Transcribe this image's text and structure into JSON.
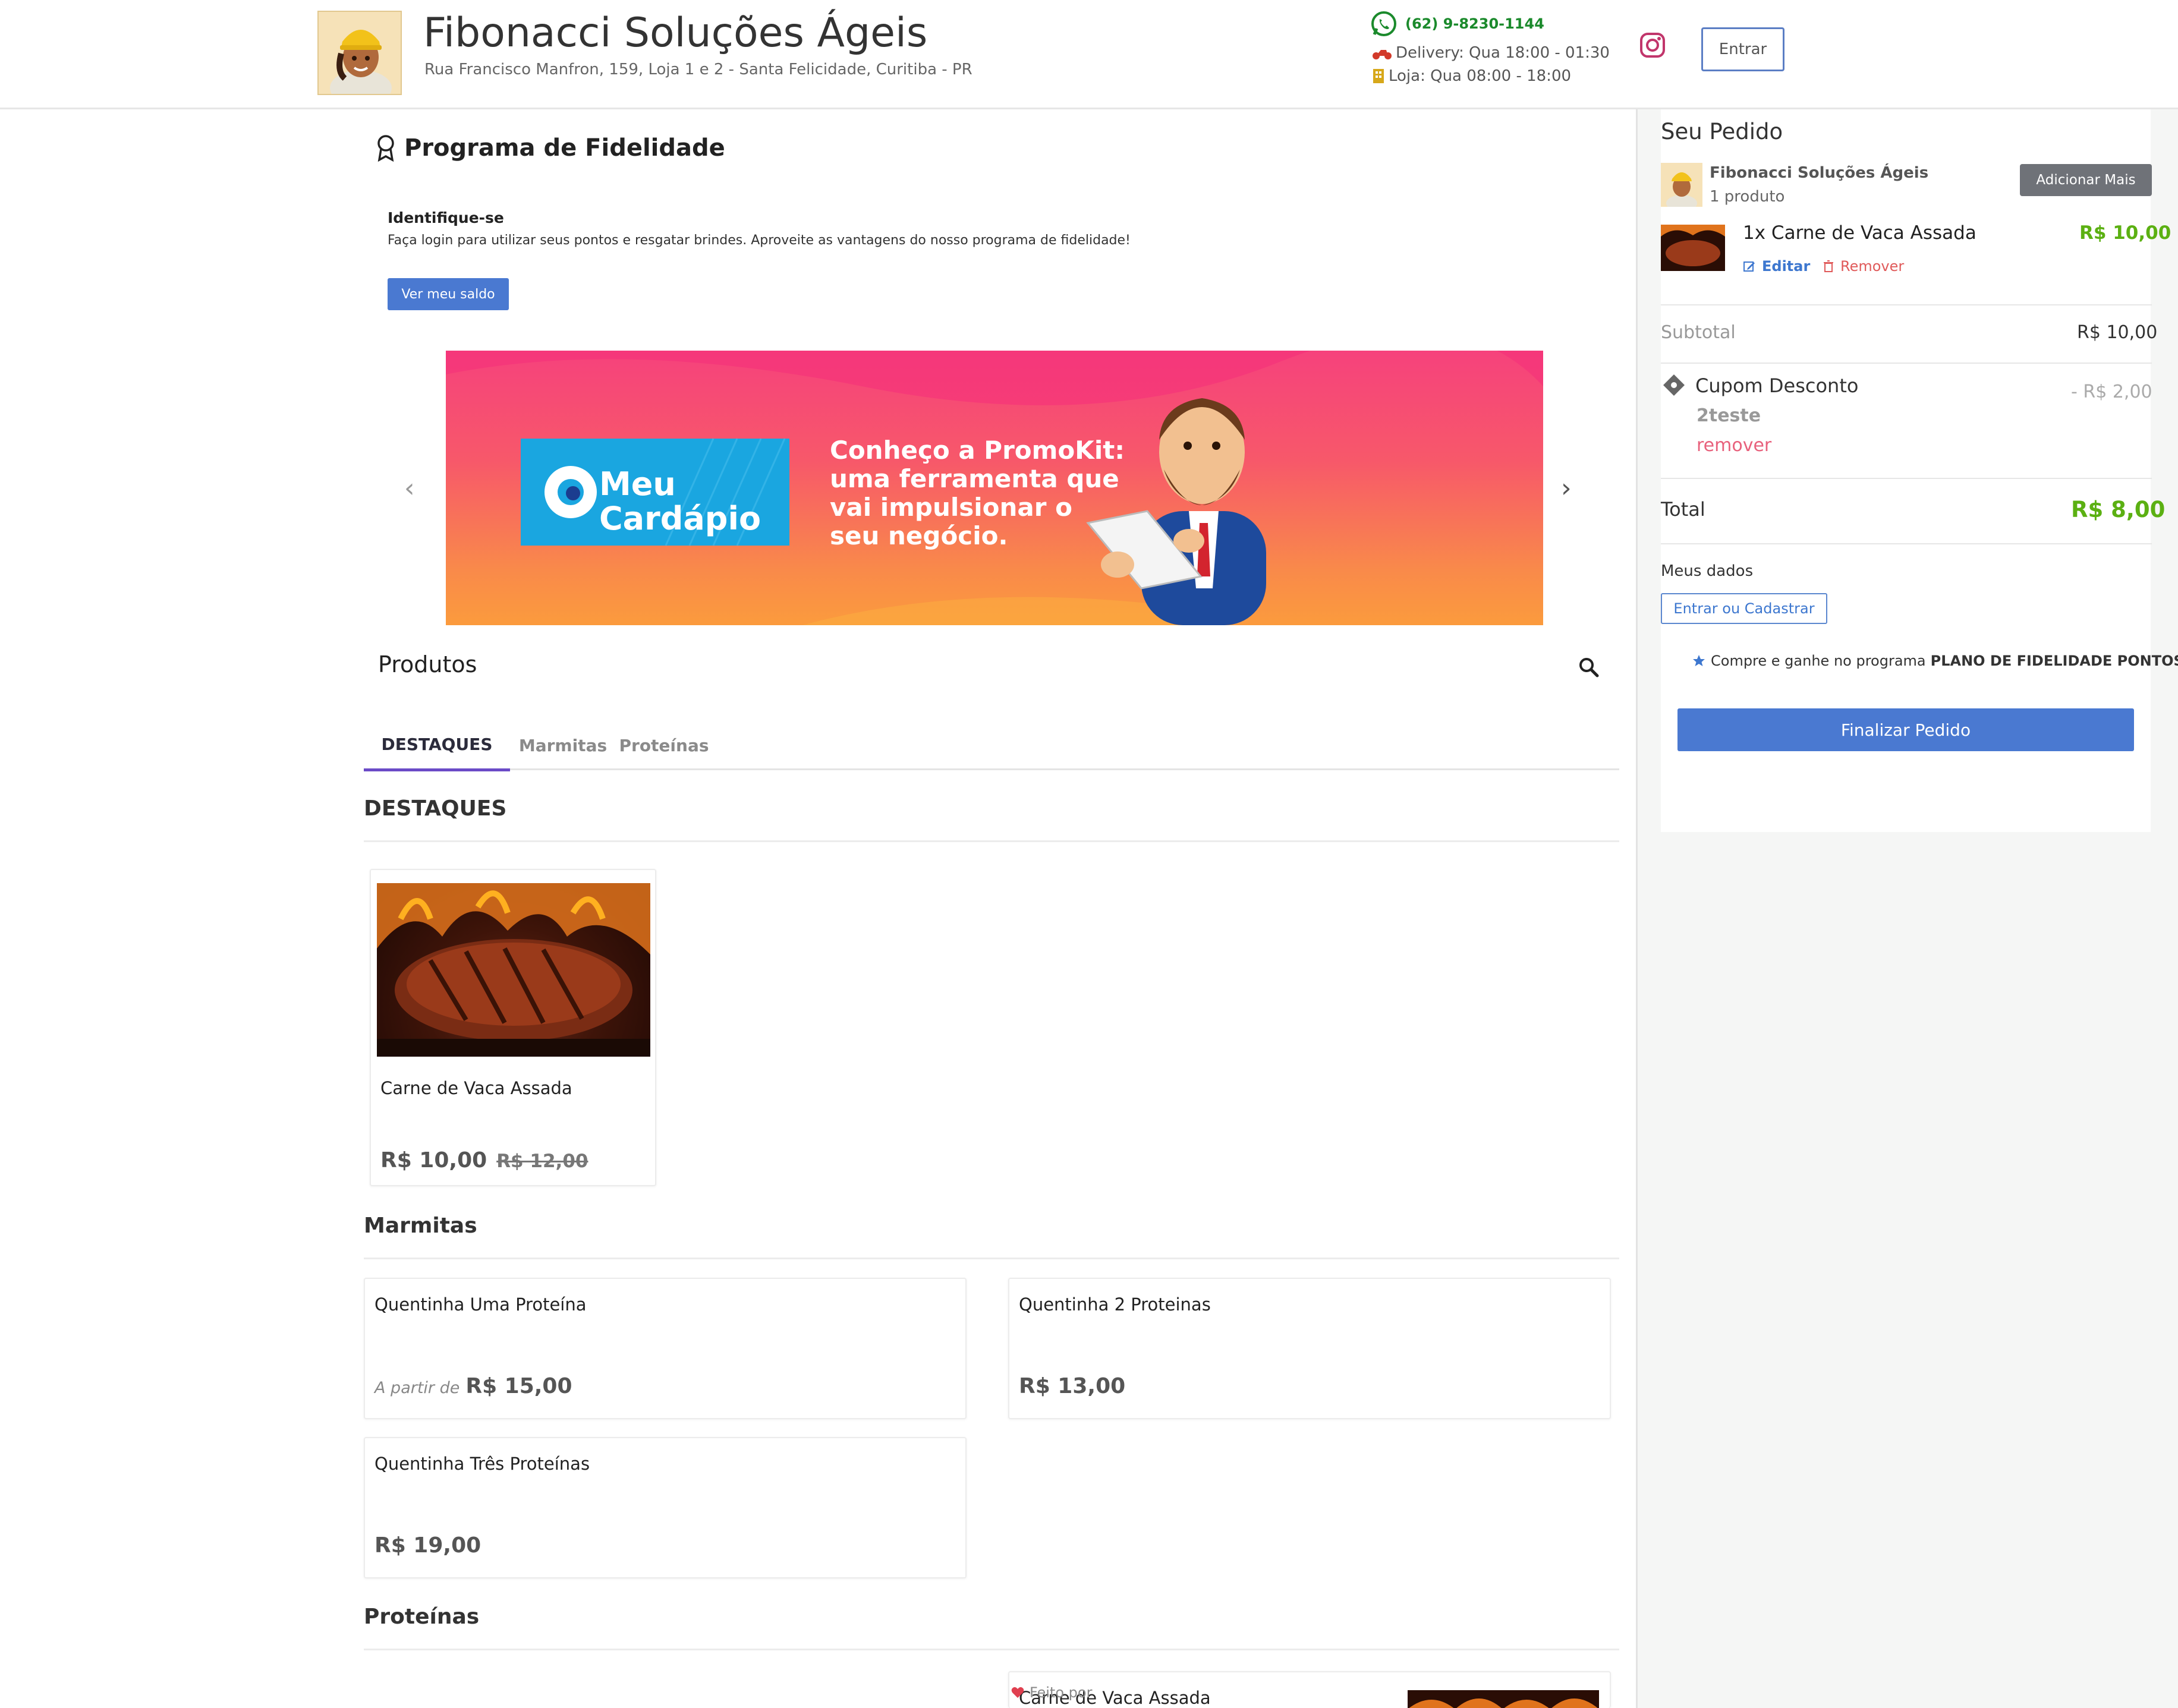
{
  "header": {
    "store_name": "Fibonacci Soluções Ágeis",
    "address": "Rua Francisco Manfron, 159, Loja 1 e 2 - Santa Felicidade, Curitiba - PR",
    "phone": "(62) 9-8230-1144",
    "delivery_hours": "Delivery: Qua 18:00 - 01:30",
    "store_hours": "Loja: Qua 08:00 - 18:00",
    "login_label": "Entrar"
  },
  "loyalty": {
    "title": "Programa de Fidelidade",
    "identify_title": "Identifique-se",
    "identify_text": "Faça login para utilizar seus pontos e resgatar brindes. Aproveite as vantagens do nosso programa de fidelidade!",
    "balance_button": "Ver meu saldo"
  },
  "banner": {
    "brand_line1": "Meu",
    "brand_line2": "Cardápio",
    "headline": [
      "Conheço a PromoKit:",
      "uma ferramenta que",
      "vai impulsionar o",
      "seu negócio."
    ],
    "prev": "‹",
    "next": "›"
  },
  "products": {
    "heading": "Produtos",
    "tabs": [
      "DESTAQUES",
      "Marmitas",
      "Proteínas"
    ],
    "sections": {
      "destaques": {
        "title": "DESTAQUES",
        "items": [
          {
            "name": "Carne de Vaca Assada",
            "price": "R$ 10,00",
            "old_price": "R$ 12,00"
          }
        ]
      },
      "marmitas": {
        "title": "Marmitas",
        "items": [
          {
            "name": "Quentinha Uma Proteína",
            "prefix": "A partir de",
            "price": "R$ 15,00"
          },
          {
            "name": "Quentinha 2 Proteinas",
            "price": "R$ 13,00"
          },
          {
            "name": "Quentinha Três Proteínas",
            "price": "R$ 19,00"
          }
        ]
      },
      "proteinas": {
        "title": "Proteínas",
        "items": [
          {
            "name": "Carne de Vaca Assada"
          }
        ]
      }
    }
  },
  "order": {
    "title": "Seu Pedido",
    "store_name": "Fibonacci Soluções Ágeis",
    "product_count": "1 produto",
    "add_more": "Adicionar Mais",
    "item": {
      "name": "1x Carne de Vaca Assada",
      "price": "R$ 10,00",
      "edit": "Editar",
      "remove": "Remover"
    },
    "subtotal_label": "Subtotal",
    "subtotal_value": "R$ 10,00",
    "coupon_label": "Cupom Desconto",
    "coupon_value": "- R$ 2,00",
    "coupon_code": "2teste",
    "coupon_remove": "remover",
    "total_label": "Total",
    "total_value": "R$ 8,00",
    "my_data": "Meus dados",
    "signin_button": "Entrar ou Cadastrar",
    "loyalty_note_prefix": "Compre e ganhe no programa",
    "loyalty_note_program": "PLANO DE FIDELIDADE PONTOS",
    "finish_button": "Finalizar Pedido"
  },
  "footer": {
    "powered_by": "Feito por"
  },
  "colors": {
    "primary": "#4a79d1",
    "price_green": "#5bb012",
    "tab_accent": "#6b4bc7",
    "whatsapp": "#1b8a2c",
    "danger": "#e05a5a"
  },
  "icons": [
    "whatsapp-icon",
    "motorcycle-icon",
    "building-icon",
    "instagram-icon",
    "ribbon-icon",
    "search-icon",
    "edit-icon",
    "trash-icon",
    "ticket-icon",
    "star-icon",
    "heart-icon"
  ]
}
